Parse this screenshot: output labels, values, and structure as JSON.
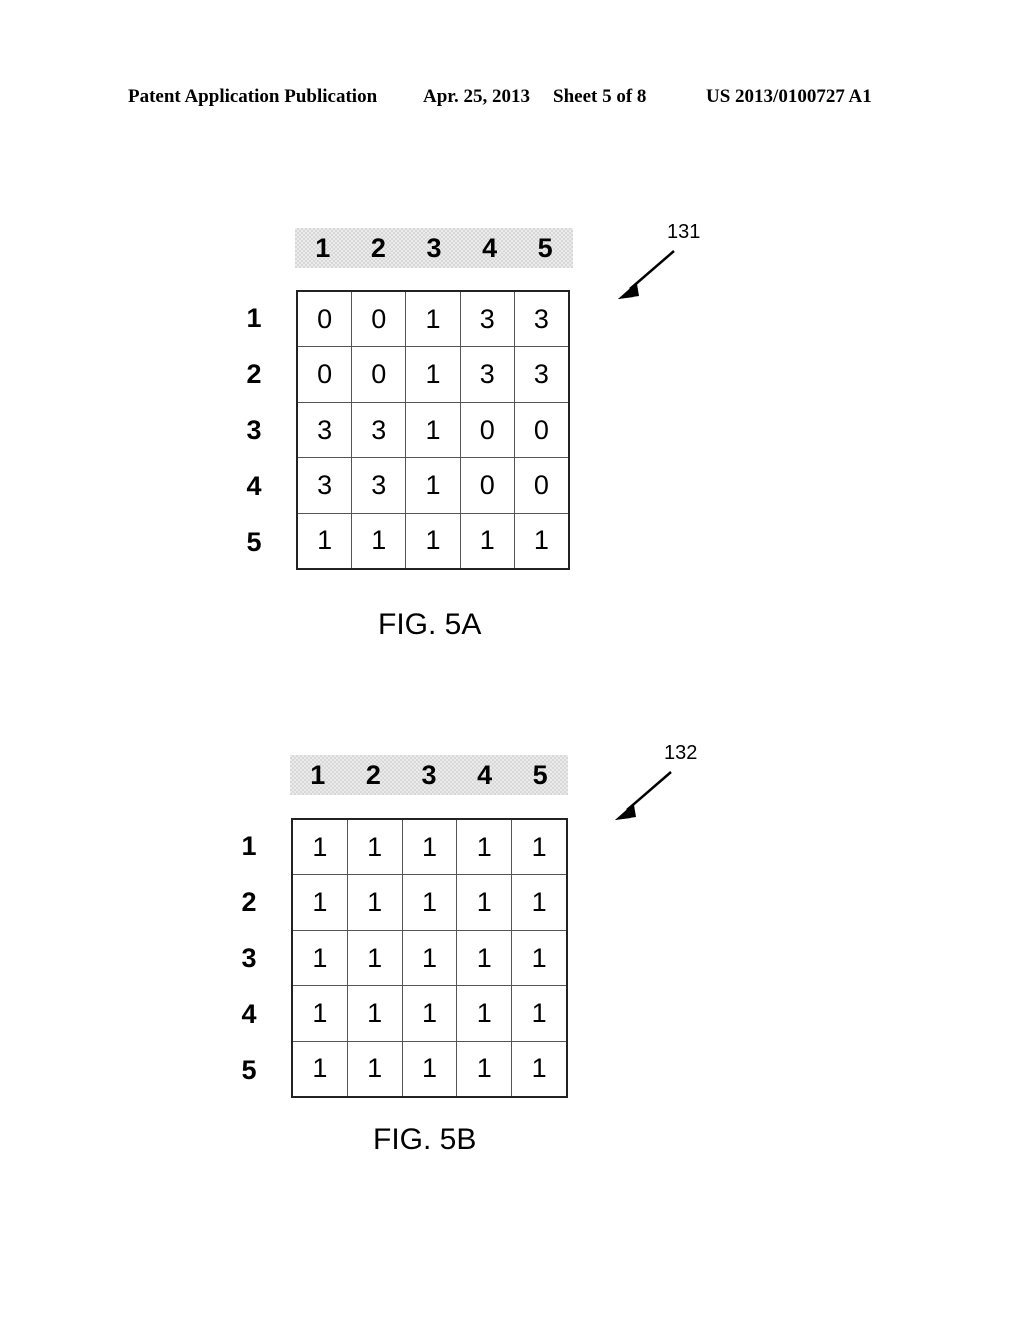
{
  "page_header": {
    "publication": "Patent Application Publication",
    "date": "Apr. 25, 2013",
    "sheet": "Sheet 5 of 8",
    "patent_number": "US 2013/0100727 A1"
  },
  "figures": [
    {
      "id": "fig-5a",
      "caption": "FIG. 5A",
      "reference_number": "131",
      "column_headers": [
        "1",
        "2",
        "3",
        "4",
        "5"
      ],
      "row_headers": [
        "1",
        "2",
        "3",
        "4",
        "5"
      ],
      "rows": [
        [
          "0",
          "0",
          "1",
          "3",
          "3"
        ],
        [
          "0",
          "0",
          "1",
          "3",
          "3"
        ],
        [
          "3",
          "3",
          "1",
          "0",
          "0"
        ],
        [
          "3",
          "3",
          "1",
          "0",
          "0"
        ],
        [
          "1",
          "1",
          "1",
          "1",
          "1"
        ]
      ]
    },
    {
      "id": "fig-5b",
      "caption": "FIG. 5B",
      "reference_number": "132",
      "column_headers": [
        "1",
        "2",
        "3",
        "4",
        "5"
      ],
      "row_headers": [
        "1",
        "2",
        "3",
        "4",
        "5"
      ],
      "rows": [
        [
          "1",
          "1",
          "1",
          "1",
          "1"
        ],
        [
          "1",
          "1",
          "1",
          "1",
          "1"
        ],
        [
          "1",
          "1",
          "1",
          "1",
          "1"
        ],
        [
          "1",
          "1",
          "1",
          "1",
          "1"
        ],
        [
          "1",
          "1",
          "1",
          "1",
          "1"
        ]
      ]
    }
  ],
  "colors": {
    "ink": "#000000",
    "grid_border": "#222222",
    "grid_line": "#555555",
    "header_band": "#ebebeb",
    "page_background": "#ffffff"
  }
}
